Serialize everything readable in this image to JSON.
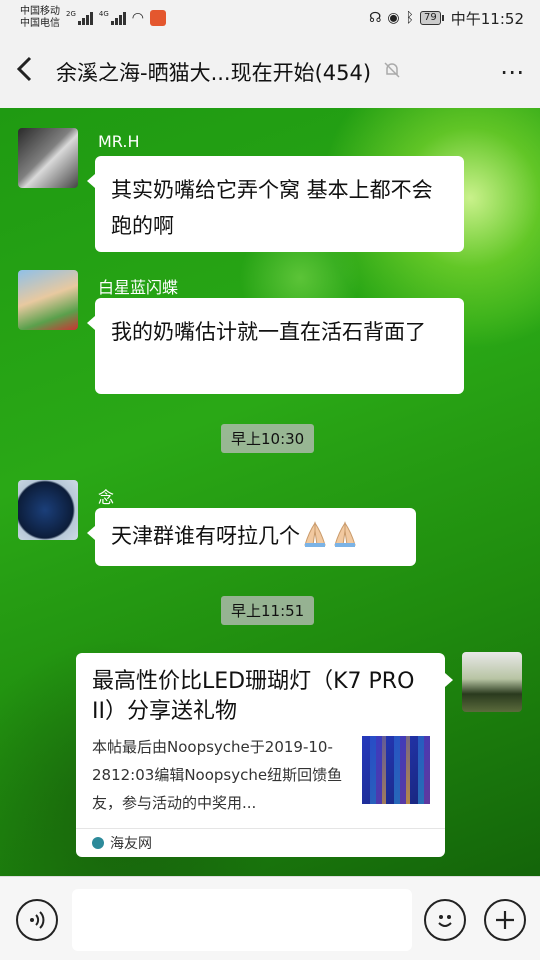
{
  "status_bar": {
    "carrier1": "中国移动",
    "carrier2": "中国电信",
    "net1": "2G",
    "net2": "4G",
    "battery": "79",
    "time": "中午11:52"
  },
  "header": {
    "title": "余溪之海-晒猫大...现在开始(454)"
  },
  "messages": [
    {
      "sender": "MR.H",
      "text": "其实奶嘴给它弄个窝  基本上都不会跑的啊"
    },
    {
      "sender": "白星蓝闪蝶",
      "text": "我的奶嘴估计就一直在活石背面了"
    },
    {
      "timestamp": "早上10:30"
    },
    {
      "sender": "念",
      "text": "天津群谁有呀拉几个"
    },
    {
      "timestamp": "早上11:51"
    }
  ],
  "card": {
    "title": "最高性价比LED珊瑚灯（K7 PRO II）分享送礼物",
    "desc": "本帖最后由Noopsyche于2019-10-2812:03编辑Noopsyche纽斯回馈鱼友，参与活动的中奖用...",
    "source": "海友网"
  },
  "colors": {
    "chat_green": "#2aa816",
    "timestamp_bg": "#bebebe"
  }
}
